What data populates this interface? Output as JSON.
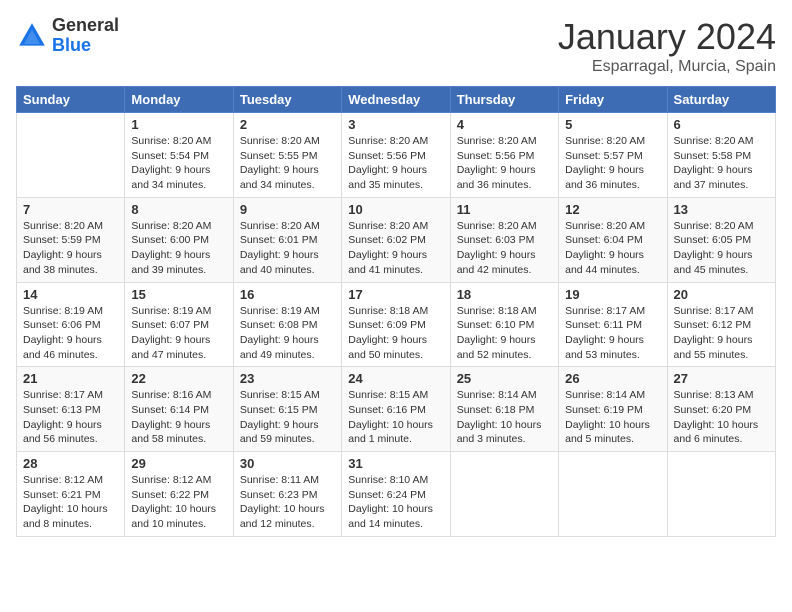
{
  "header": {
    "logo_general": "General",
    "logo_blue": "Blue",
    "month_title": "January 2024",
    "location": "Esparragal, Murcia, Spain"
  },
  "weekdays": [
    "Sunday",
    "Monday",
    "Tuesday",
    "Wednesday",
    "Thursday",
    "Friday",
    "Saturday"
  ],
  "weeks": [
    [
      {
        "day": "",
        "sunrise": "",
        "sunset": "",
        "daylight": ""
      },
      {
        "day": "1",
        "sunrise": "Sunrise: 8:20 AM",
        "sunset": "Sunset: 5:54 PM",
        "daylight": "Daylight: 9 hours and 34 minutes."
      },
      {
        "day": "2",
        "sunrise": "Sunrise: 8:20 AM",
        "sunset": "Sunset: 5:55 PM",
        "daylight": "Daylight: 9 hours and 34 minutes."
      },
      {
        "day": "3",
        "sunrise": "Sunrise: 8:20 AM",
        "sunset": "Sunset: 5:56 PM",
        "daylight": "Daylight: 9 hours and 35 minutes."
      },
      {
        "day": "4",
        "sunrise": "Sunrise: 8:20 AM",
        "sunset": "Sunset: 5:56 PM",
        "daylight": "Daylight: 9 hours and 36 minutes."
      },
      {
        "day": "5",
        "sunrise": "Sunrise: 8:20 AM",
        "sunset": "Sunset: 5:57 PM",
        "daylight": "Daylight: 9 hours and 36 minutes."
      },
      {
        "day": "6",
        "sunrise": "Sunrise: 8:20 AM",
        "sunset": "Sunset: 5:58 PM",
        "daylight": "Daylight: 9 hours and 37 minutes."
      }
    ],
    [
      {
        "day": "7",
        "sunrise": "Sunrise: 8:20 AM",
        "sunset": "Sunset: 5:59 PM",
        "daylight": "Daylight: 9 hours and 38 minutes."
      },
      {
        "day": "8",
        "sunrise": "Sunrise: 8:20 AM",
        "sunset": "Sunset: 6:00 PM",
        "daylight": "Daylight: 9 hours and 39 minutes."
      },
      {
        "day": "9",
        "sunrise": "Sunrise: 8:20 AM",
        "sunset": "Sunset: 6:01 PM",
        "daylight": "Daylight: 9 hours and 40 minutes."
      },
      {
        "day": "10",
        "sunrise": "Sunrise: 8:20 AM",
        "sunset": "Sunset: 6:02 PM",
        "daylight": "Daylight: 9 hours and 41 minutes."
      },
      {
        "day": "11",
        "sunrise": "Sunrise: 8:20 AM",
        "sunset": "Sunset: 6:03 PM",
        "daylight": "Daylight: 9 hours and 42 minutes."
      },
      {
        "day": "12",
        "sunrise": "Sunrise: 8:20 AM",
        "sunset": "Sunset: 6:04 PM",
        "daylight": "Daylight: 9 hours and 44 minutes."
      },
      {
        "day": "13",
        "sunrise": "Sunrise: 8:20 AM",
        "sunset": "Sunset: 6:05 PM",
        "daylight": "Daylight: 9 hours and 45 minutes."
      }
    ],
    [
      {
        "day": "14",
        "sunrise": "Sunrise: 8:19 AM",
        "sunset": "Sunset: 6:06 PM",
        "daylight": "Daylight: 9 hours and 46 minutes."
      },
      {
        "day": "15",
        "sunrise": "Sunrise: 8:19 AM",
        "sunset": "Sunset: 6:07 PM",
        "daylight": "Daylight: 9 hours and 47 minutes."
      },
      {
        "day": "16",
        "sunrise": "Sunrise: 8:19 AM",
        "sunset": "Sunset: 6:08 PM",
        "daylight": "Daylight: 9 hours and 49 minutes."
      },
      {
        "day": "17",
        "sunrise": "Sunrise: 8:18 AM",
        "sunset": "Sunset: 6:09 PM",
        "daylight": "Daylight: 9 hours and 50 minutes."
      },
      {
        "day": "18",
        "sunrise": "Sunrise: 8:18 AM",
        "sunset": "Sunset: 6:10 PM",
        "daylight": "Daylight: 9 hours and 52 minutes."
      },
      {
        "day": "19",
        "sunrise": "Sunrise: 8:17 AM",
        "sunset": "Sunset: 6:11 PM",
        "daylight": "Daylight: 9 hours and 53 minutes."
      },
      {
        "day": "20",
        "sunrise": "Sunrise: 8:17 AM",
        "sunset": "Sunset: 6:12 PM",
        "daylight": "Daylight: 9 hours and 55 minutes."
      }
    ],
    [
      {
        "day": "21",
        "sunrise": "Sunrise: 8:17 AM",
        "sunset": "Sunset: 6:13 PM",
        "daylight": "Daylight: 9 hours and 56 minutes."
      },
      {
        "day": "22",
        "sunrise": "Sunrise: 8:16 AM",
        "sunset": "Sunset: 6:14 PM",
        "daylight": "Daylight: 9 hours and 58 minutes."
      },
      {
        "day": "23",
        "sunrise": "Sunrise: 8:15 AM",
        "sunset": "Sunset: 6:15 PM",
        "daylight": "Daylight: 9 hours and 59 minutes."
      },
      {
        "day": "24",
        "sunrise": "Sunrise: 8:15 AM",
        "sunset": "Sunset: 6:16 PM",
        "daylight": "Daylight: 10 hours and 1 minute."
      },
      {
        "day": "25",
        "sunrise": "Sunrise: 8:14 AM",
        "sunset": "Sunset: 6:18 PM",
        "daylight": "Daylight: 10 hours and 3 minutes."
      },
      {
        "day": "26",
        "sunrise": "Sunrise: 8:14 AM",
        "sunset": "Sunset: 6:19 PM",
        "daylight": "Daylight: 10 hours and 5 minutes."
      },
      {
        "day": "27",
        "sunrise": "Sunrise: 8:13 AM",
        "sunset": "Sunset: 6:20 PM",
        "daylight": "Daylight: 10 hours and 6 minutes."
      }
    ],
    [
      {
        "day": "28",
        "sunrise": "Sunrise: 8:12 AM",
        "sunset": "Sunset: 6:21 PM",
        "daylight": "Daylight: 10 hours and 8 minutes."
      },
      {
        "day": "29",
        "sunrise": "Sunrise: 8:12 AM",
        "sunset": "Sunset: 6:22 PM",
        "daylight": "Daylight: 10 hours and 10 minutes."
      },
      {
        "day": "30",
        "sunrise": "Sunrise: 8:11 AM",
        "sunset": "Sunset: 6:23 PM",
        "daylight": "Daylight: 10 hours and 12 minutes."
      },
      {
        "day": "31",
        "sunrise": "Sunrise: 8:10 AM",
        "sunset": "Sunset: 6:24 PM",
        "daylight": "Daylight: 10 hours and 14 minutes."
      },
      {
        "day": "",
        "sunrise": "",
        "sunset": "",
        "daylight": ""
      },
      {
        "day": "",
        "sunrise": "",
        "sunset": "",
        "daylight": ""
      },
      {
        "day": "",
        "sunrise": "",
        "sunset": "",
        "daylight": ""
      }
    ]
  ]
}
